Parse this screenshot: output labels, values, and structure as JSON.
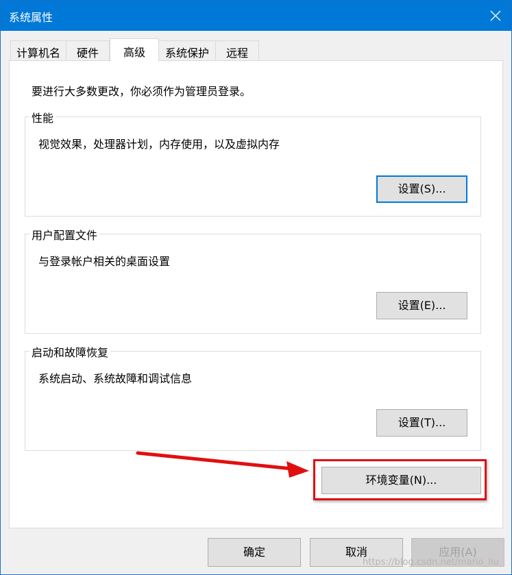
{
  "window": {
    "title": "系统属性",
    "close_icon": "close-icon"
  },
  "tabs": [
    {
      "label": "计算机名",
      "active": false
    },
    {
      "label": "硬件",
      "active": false
    },
    {
      "label": "高级",
      "active": true
    },
    {
      "label": "系统保护",
      "active": false
    },
    {
      "label": "远程",
      "active": false
    }
  ],
  "advanced": {
    "admin_note": "要进行大多数更改，你必须作为管理员登录。",
    "performance": {
      "legend": "性能",
      "description": "视觉效果，处理器计划，内存使用，以及虚拟内存",
      "button": "设置(S)..."
    },
    "user_profiles": {
      "legend": "用户配置文件",
      "description": "与登录帐户相关的桌面设置",
      "button": "设置(E)..."
    },
    "startup_recovery": {
      "legend": "启动和故障恢复",
      "description": "系统启动、系统故障和调试信息",
      "button": "设置(T)..."
    },
    "env_button": "环境变量(N)..."
  },
  "footer": {
    "ok": "确定",
    "cancel": "取消",
    "apply": "应用(A)"
  },
  "annotation": {
    "color": "#e01010"
  },
  "watermark": "https://blog.csdn.net/mario_liu"
}
